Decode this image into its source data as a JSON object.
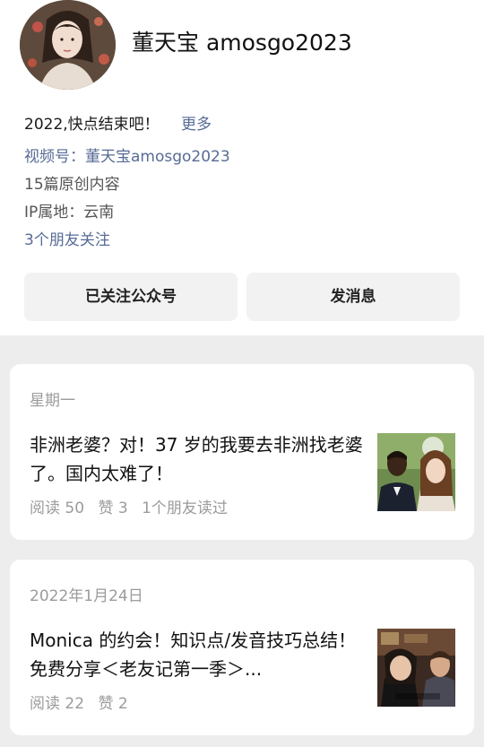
{
  "profile": {
    "name": "董天宝 amosgo2023",
    "bio": "2022,快点结束吧！",
    "more": "更多",
    "channel": "视频号：董天宝amosgo2023",
    "article_count": "15篇原创内容",
    "ip_location": "IP属地：云南",
    "friends_following": "3个朋友关注"
  },
  "buttons": {
    "followed": "已关注公众号",
    "message": "发消息"
  },
  "articles": [
    {
      "date": "星期一",
      "title": "非洲老婆？对！37 岁的我要去非洲找老婆了。国内太难了！",
      "reads": "阅读 50",
      "likes": "赞 3",
      "friends_read": "1个朋友读过"
    },
    {
      "date": "2022年1月24日",
      "title": "Monica 的约会！知识点/发音技巧总结！免费分享＜老友记第一季＞...",
      "reads": "阅读 22",
      "likes": "赞 2"
    }
  ],
  "colors": {
    "link": "#576b95",
    "background": "#ededed",
    "muted": "#9b9b9b"
  }
}
